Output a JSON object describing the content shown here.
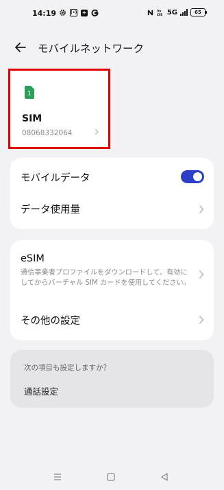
{
  "status_bar": {
    "time": "14:19",
    "network": "5G",
    "battery": "65"
  },
  "header": {
    "title": "モバイルネットワーク"
  },
  "sim": {
    "icon_label": "1",
    "name": "SIM",
    "number": "08068332064"
  },
  "mobile_section": {
    "mobile_data_label": "モバイルデータ",
    "mobile_data_on": true,
    "data_usage_label": "データ使用量"
  },
  "esim_section": {
    "title": "eSIM",
    "description": "通信事業者プロファイルをダウンロードして、有効にしてからバーチャル SIM カードを使用してください。",
    "other_settings_label": "その他の設定"
  },
  "suggestions": {
    "heading": "次の項目も設定しますか？",
    "item": "通話設定"
  },
  "colors": {
    "accent": "#2d3ec7",
    "sim_icon": "#2e9d5a",
    "highlight_border": "#e00000"
  }
}
